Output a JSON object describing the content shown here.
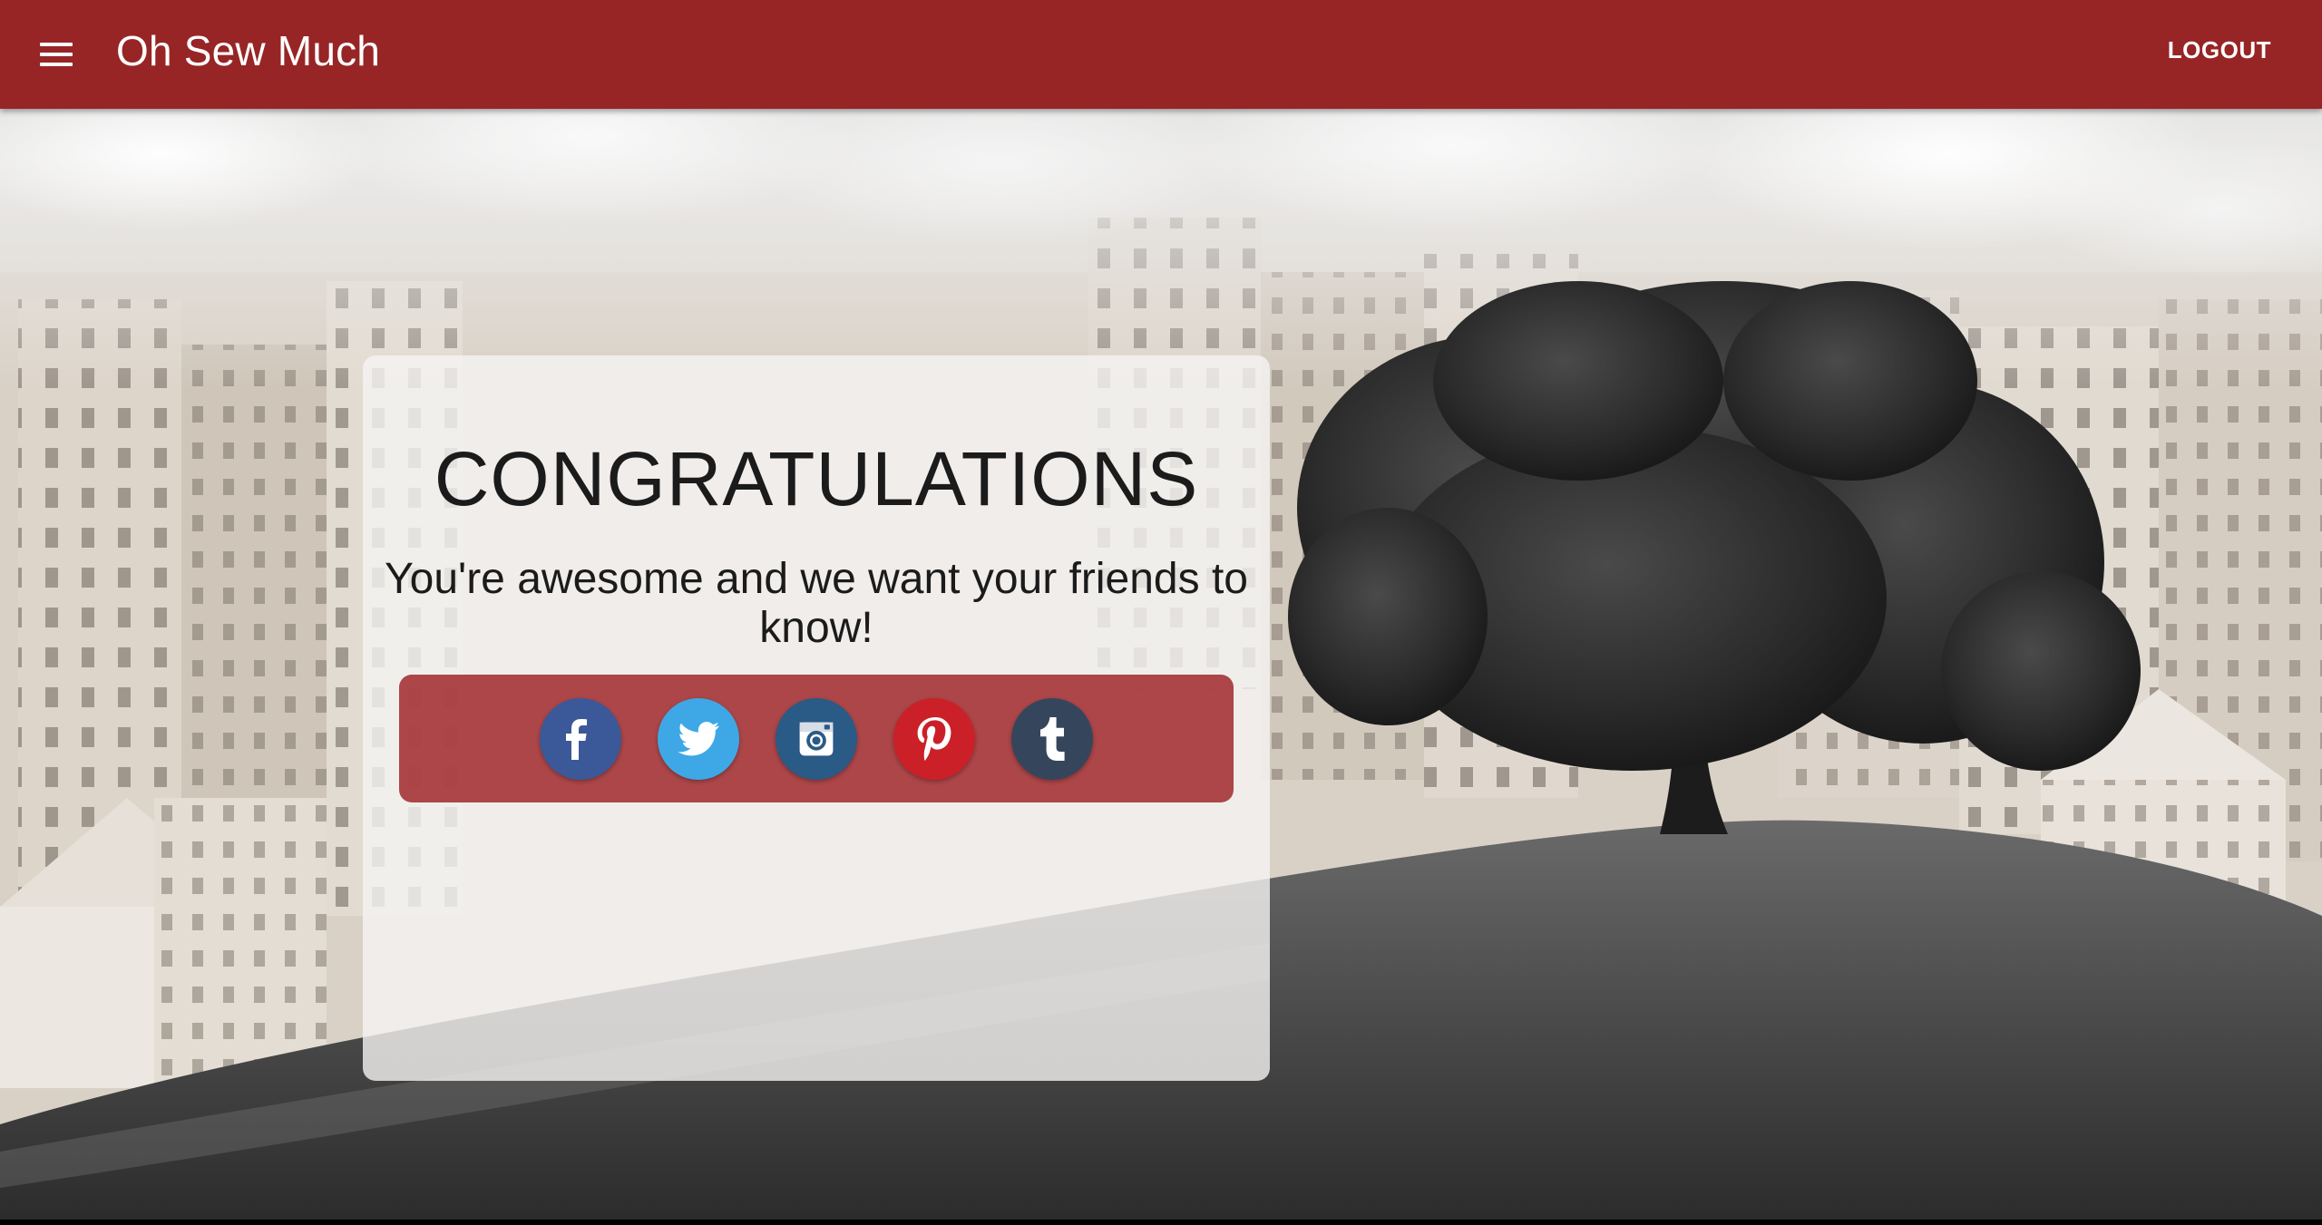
{
  "app": {
    "title": "Oh Sew Much",
    "accent_color": "#972526"
  },
  "appbar": {
    "menu_icon": "hamburger-menu-icon",
    "logout_label": "LOGOUT"
  },
  "card": {
    "heading": "CONGRATULATIONS",
    "message": "You're awesome and we want your friends to know!"
  },
  "share": {
    "buttons": [
      {
        "network": "facebook",
        "icon": "facebook-icon",
        "color": "#3b5998"
      },
      {
        "network": "twitter",
        "icon": "twitter-icon",
        "color": "#3ea8e6"
      },
      {
        "network": "instagram",
        "icon": "instagram-icon",
        "color": "#2a5a86"
      },
      {
        "network": "pinterest",
        "icon": "pinterest-icon",
        "color": "#cb2027"
      },
      {
        "network": "tumblr",
        "icon": "tumblr-icon",
        "color": "#35465c"
      }
    ]
  }
}
